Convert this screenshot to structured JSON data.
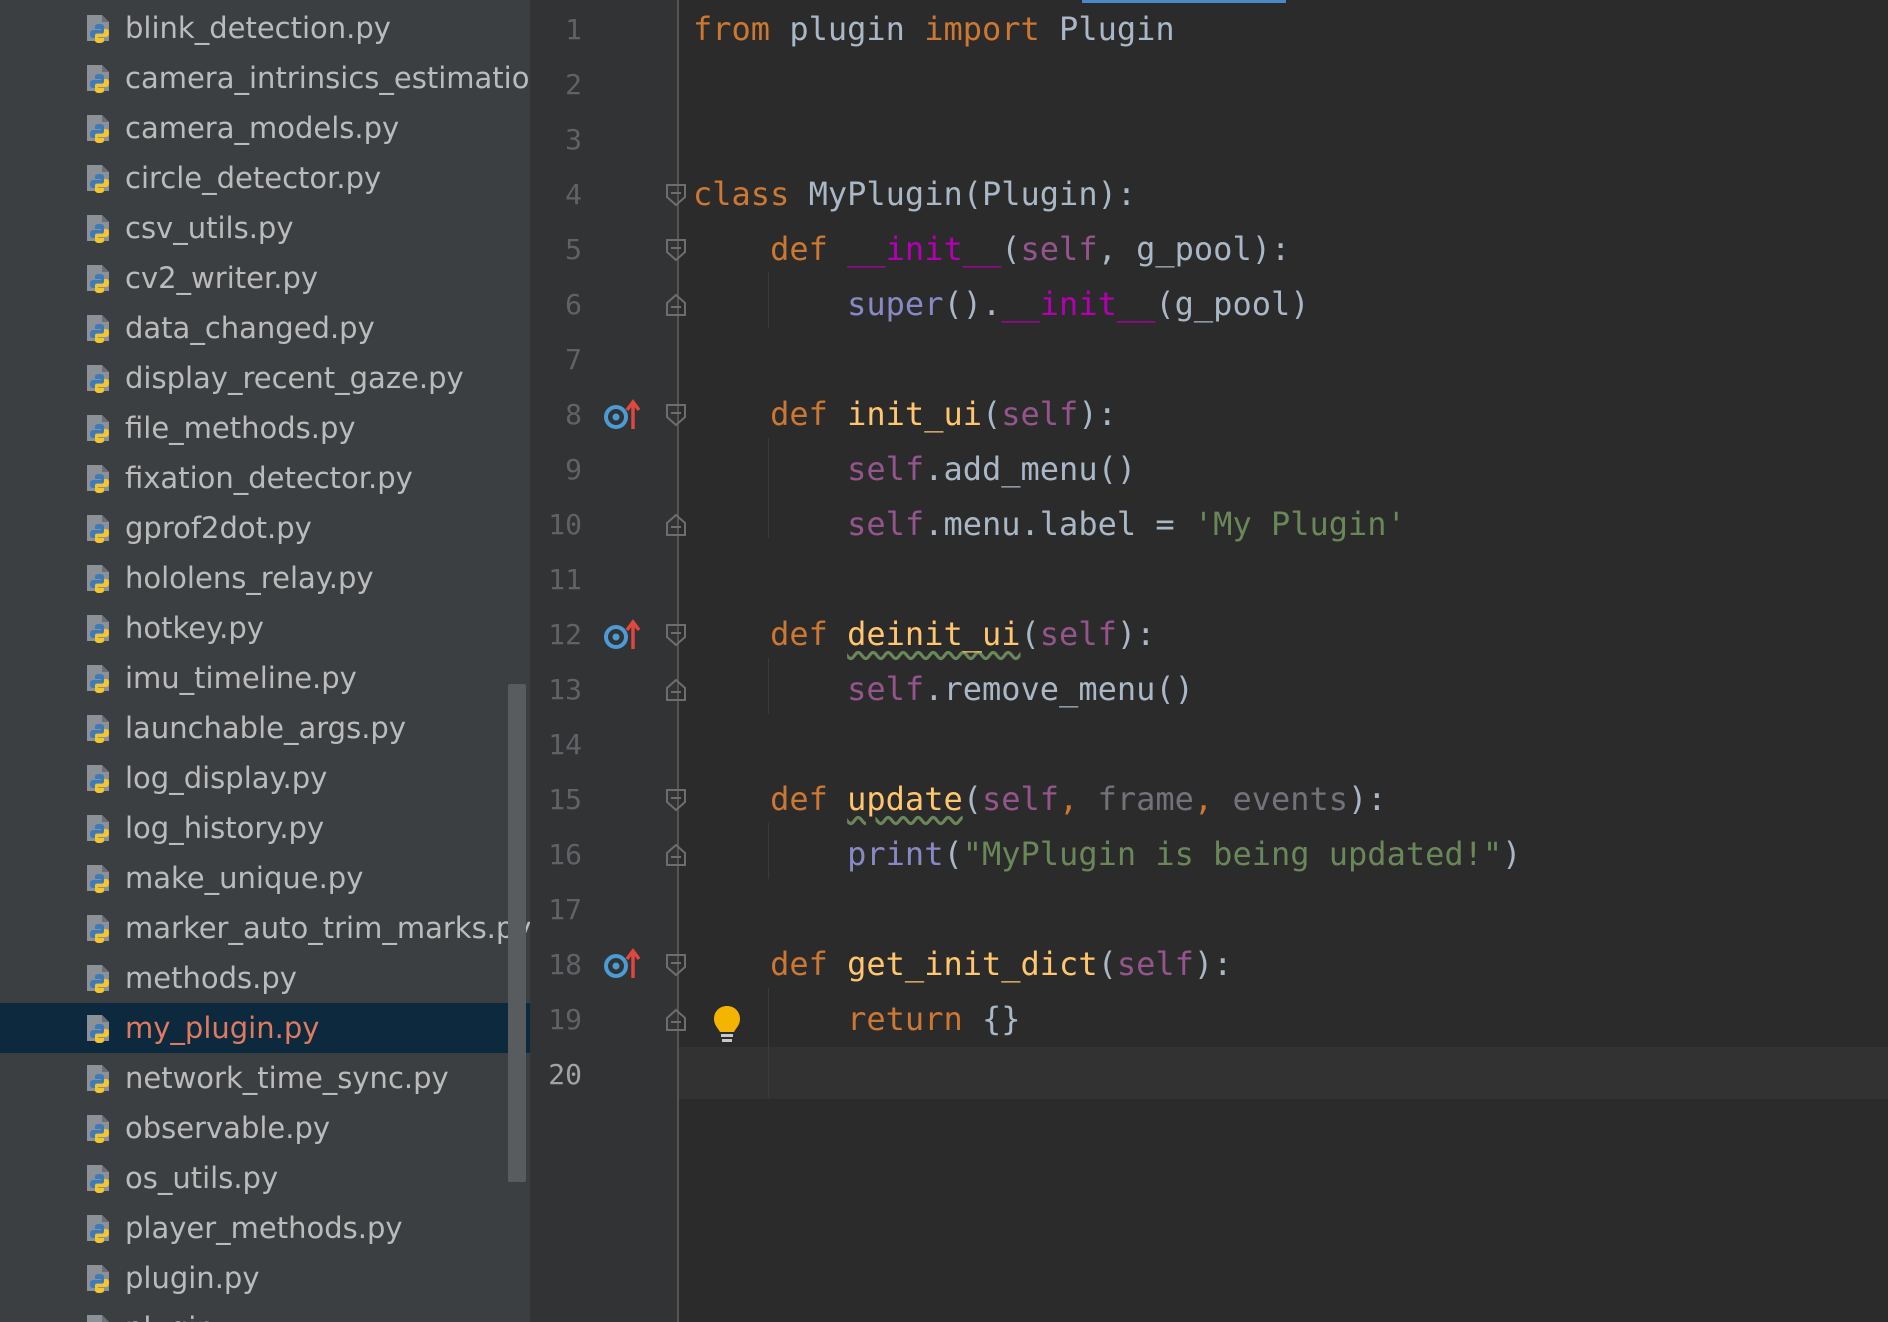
{
  "project_tree": {
    "files": [
      {
        "name": "blink_detection.py"
      },
      {
        "name": "camera_intrinsics_estimation.py"
      },
      {
        "name": "camera_models.py"
      },
      {
        "name": "circle_detector.py"
      },
      {
        "name": "csv_utils.py"
      },
      {
        "name": "cv2_writer.py"
      },
      {
        "name": "data_changed.py"
      },
      {
        "name": "display_recent_gaze.py"
      },
      {
        "name": "file_methods.py"
      },
      {
        "name": "fixation_detector.py"
      },
      {
        "name": "gprof2dot.py"
      },
      {
        "name": "hololens_relay.py"
      },
      {
        "name": "hotkey.py"
      },
      {
        "name": "imu_timeline.py"
      },
      {
        "name": "launchable_args.py"
      },
      {
        "name": "log_display.py"
      },
      {
        "name": "log_history.py"
      },
      {
        "name": "make_unique.py"
      },
      {
        "name": "marker_auto_trim_marks.py"
      },
      {
        "name": "methods.py"
      },
      {
        "name": "my_plugin.py",
        "selected": true
      },
      {
        "name": "network_time_sync.py"
      },
      {
        "name": "observable.py"
      },
      {
        "name": "os_utils.py"
      },
      {
        "name": "player_methods.py"
      },
      {
        "name": "plugin.py"
      },
      {
        "name": "plugin..."
      }
    ]
  },
  "editor": {
    "line_numbers": [
      "1",
      "2",
      "3",
      "4",
      "5",
      "6",
      "7",
      "8",
      "9",
      "10",
      "11",
      "12",
      "13",
      "14",
      "15",
      "16",
      "17",
      "18",
      "19",
      "20"
    ],
    "current_line": "20",
    "code": {
      "l1": {
        "from": "from",
        "mod": " plugin ",
        "import": "import",
        "name": " Plugin"
      },
      "l4": {
        "class": "class",
        "name": " MyPlugin(Plugin):"
      },
      "l5": {
        "def": "def",
        "fn": "__init__",
        "open": "(",
        "self": "self",
        "rest": ", g_pool):"
      },
      "l6": {
        "super": "super",
        "mid": "().",
        "fn": "__init__",
        "rest": "(g_pool)"
      },
      "l8": {
        "def": "def",
        "fn": "init_ui",
        "open": "(",
        "self": "self",
        "rest": "):"
      },
      "l9": {
        "self": "self",
        "rest": ".add_menu()"
      },
      "l10": {
        "self": "self",
        "mid": ".menu.label = ",
        "str": "'My Plugin'"
      },
      "l12": {
        "def": "def",
        "fn": "deinit_ui",
        "open": "(",
        "self": "self",
        "rest": "):"
      },
      "l13": {
        "self": "self",
        "rest": ".remove_menu()"
      },
      "l15": {
        "def": "def",
        "fn": "update",
        "open": "(",
        "self": "self",
        "sep1": ", ",
        "p1": "frame",
        "sep2": ", ",
        "p2": "events",
        "rest": "):"
      },
      "l16": {
        "print": "print",
        "open": "(",
        "str": "\"MyPlugin is being updated!\"",
        "close": ")"
      },
      "l18": {
        "def": "def",
        "fn": "get_init_dict",
        "open": "(",
        "self": "self",
        "rest": "):"
      },
      "l19": {
        "return": "return",
        "rest": " {}"
      }
    }
  },
  "icons": {
    "file": "python-file-icon",
    "override": "overrides-method-icon",
    "fold": "fold-marker-icon",
    "intention": "lightbulb-icon"
  },
  "colors": {
    "keyword": "#cc7832",
    "function": "#ffc66d",
    "self": "#94558d",
    "magic": "#b200b2",
    "string": "#6a8759",
    "selected_file": "#e07a5f"
  }
}
